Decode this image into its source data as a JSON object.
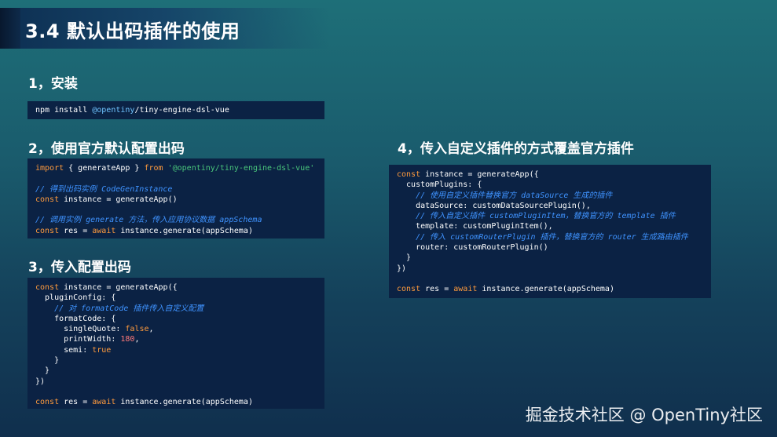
{
  "slide": {
    "title": "3.4 默认出码插件的使用",
    "watermark": "掘金技术社区 @ OpenTiny社区"
  },
  "sections": {
    "install": {
      "heading": "1，安装",
      "cmd": "npm install ",
      "scope": "@opentiny",
      "pkg": "/tiny-engine-dsl-vue"
    },
    "official": {
      "heading": "2，使用官方默认配置出码",
      "l1_kw": "import",
      "l1_mid": " { generateApp } ",
      "l1_from": "from",
      "l1_str": " '@opentiny/tiny-engine-dsl-vue'",
      "l2_cm": "// 得到出码实例 CodeGenInstance",
      "l3_kw": "const",
      "l3_rest": " instance = generateApp()",
      "l4_cm": "// 调用实例 generate 方法，传入应用协议数据 appSchema",
      "l5_kw": "const",
      "l5_mid": " res = ",
      "l5_await": "await",
      "l5_rest": " instance.generate(appSchema)"
    },
    "config": {
      "heading": "3，传入配置出码",
      "l1_kw": "const",
      "l1_rest": " instance = generateApp({",
      "l2": "  pluginConfig: {",
      "l3_cm": "    // 对 formatCode 插件传入自定义配置",
      "l4": "    formatCode: {",
      "l5_a": "      singleQuote: ",
      "l5_b": "false",
      "l5_c": ",",
      "l6_a": "      printWidth: ",
      "l6_b": "180",
      "l6_c": ",",
      "l7_a": "      semi: ",
      "l7_b": "true",
      "l8": "    }",
      "l9": "  }",
      "l10": "})",
      "l11_kw": "const",
      "l11_mid": " res = ",
      "l11_await": "await",
      "l11_rest": " instance.generate(appSchema)"
    },
    "custom": {
      "heading": "4，传入自定义插件的方式覆盖官方插件",
      "l1_kw": "const",
      "l1_rest": " instance = generateApp({",
      "l2": "  customPlugins: {",
      "l3_cm": "    // 使用自定义插件替换官方 dataSource 生成的插件",
      "l4": "    dataSource: customDataSourcePlugin(),",
      "l5_cm": "    // 传入自定义插件 customPluginItem，替换官方的 template 插件",
      "l6": "    template: customPluginItem(),",
      "l7_cm": "    // 传入 customRouterPlugin 插件，替换官方的 router 生成路由插件",
      "l8": "    router: customRouterPlugin()",
      "l9": "  }",
      "l10": "})",
      "l11_kw": "const",
      "l11_mid": " res = ",
      "l11_await": "await",
      "l11_rest": " instance.generate(appSchema)"
    }
  }
}
